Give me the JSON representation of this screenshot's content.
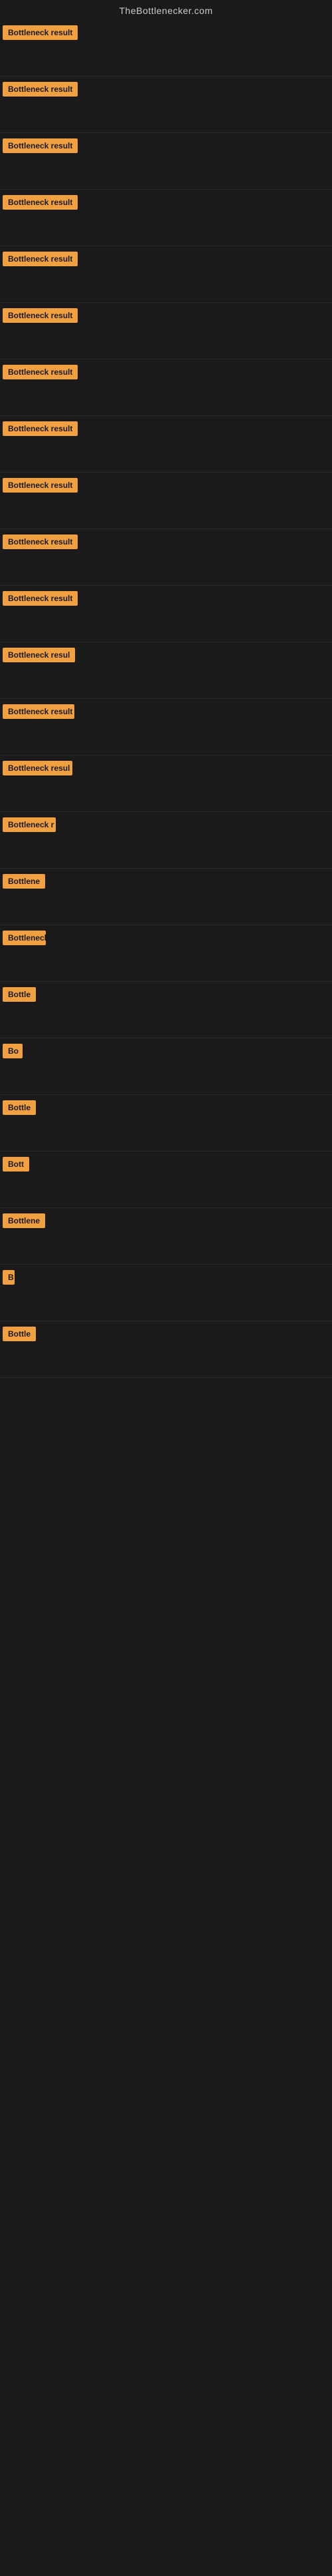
{
  "site": {
    "title": "TheBottlenecker.com"
  },
  "sections": [
    {
      "id": 1,
      "badge_text": "Bottleneck result",
      "height": 80
    },
    {
      "id": 2,
      "badge_text": "Bottleneck result",
      "height": 80
    },
    {
      "id": 3,
      "badge_text": "Bottleneck result",
      "height": 80
    },
    {
      "id": 4,
      "badge_text": "Bottleneck result",
      "height": 80
    },
    {
      "id": 5,
      "badge_text": "Bottleneck result",
      "height": 80
    },
    {
      "id": 6,
      "badge_text": "Bottleneck result",
      "height": 80
    },
    {
      "id": 7,
      "badge_text": "Bottleneck result",
      "height": 80
    },
    {
      "id": 8,
      "badge_text": "Bottleneck result",
      "height": 80
    },
    {
      "id": 9,
      "badge_text": "Bottleneck result",
      "height": 80
    },
    {
      "id": 10,
      "badge_text": "Bottleneck result",
      "height": 80
    },
    {
      "id": 11,
      "badge_text": "Bottleneck result",
      "height": 80
    },
    {
      "id": 12,
      "badge_text": "Bottleneck resul",
      "height": 80
    },
    {
      "id": 13,
      "badge_text": "Bottleneck result",
      "height": 80
    },
    {
      "id": 14,
      "badge_text": "Bottleneck resul",
      "height": 80
    },
    {
      "id": 15,
      "badge_text": "Bottleneck r",
      "height": 80
    },
    {
      "id": 16,
      "badge_text": "Bottlene",
      "height": 80
    },
    {
      "id": 17,
      "badge_text": "Bottleneck",
      "height": 80
    },
    {
      "id": 18,
      "badge_text": "Bottle",
      "height": 80
    },
    {
      "id": 19,
      "badge_text": "Bo",
      "height": 80
    },
    {
      "id": 20,
      "badge_text": "Bottle",
      "height": 80
    },
    {
      "id": 21,
      "badge_text": "Bott",
      "height": 80
    },
    {
      "id": 22,
      "badge_text": "Bottlene",
      "height": 80
    },
    {
      "id": 23,
      "badge_text": "B",
      "height": 80
    },
    {
      "id": 24,
      "badge_text": "Bottle",
      "height": 80
    }
  ],
  "colors": {
    "badge_bg": "#f0a040",
    "background": "#1a1a1a",
    "title_color": "#cccccc"
  }
}
